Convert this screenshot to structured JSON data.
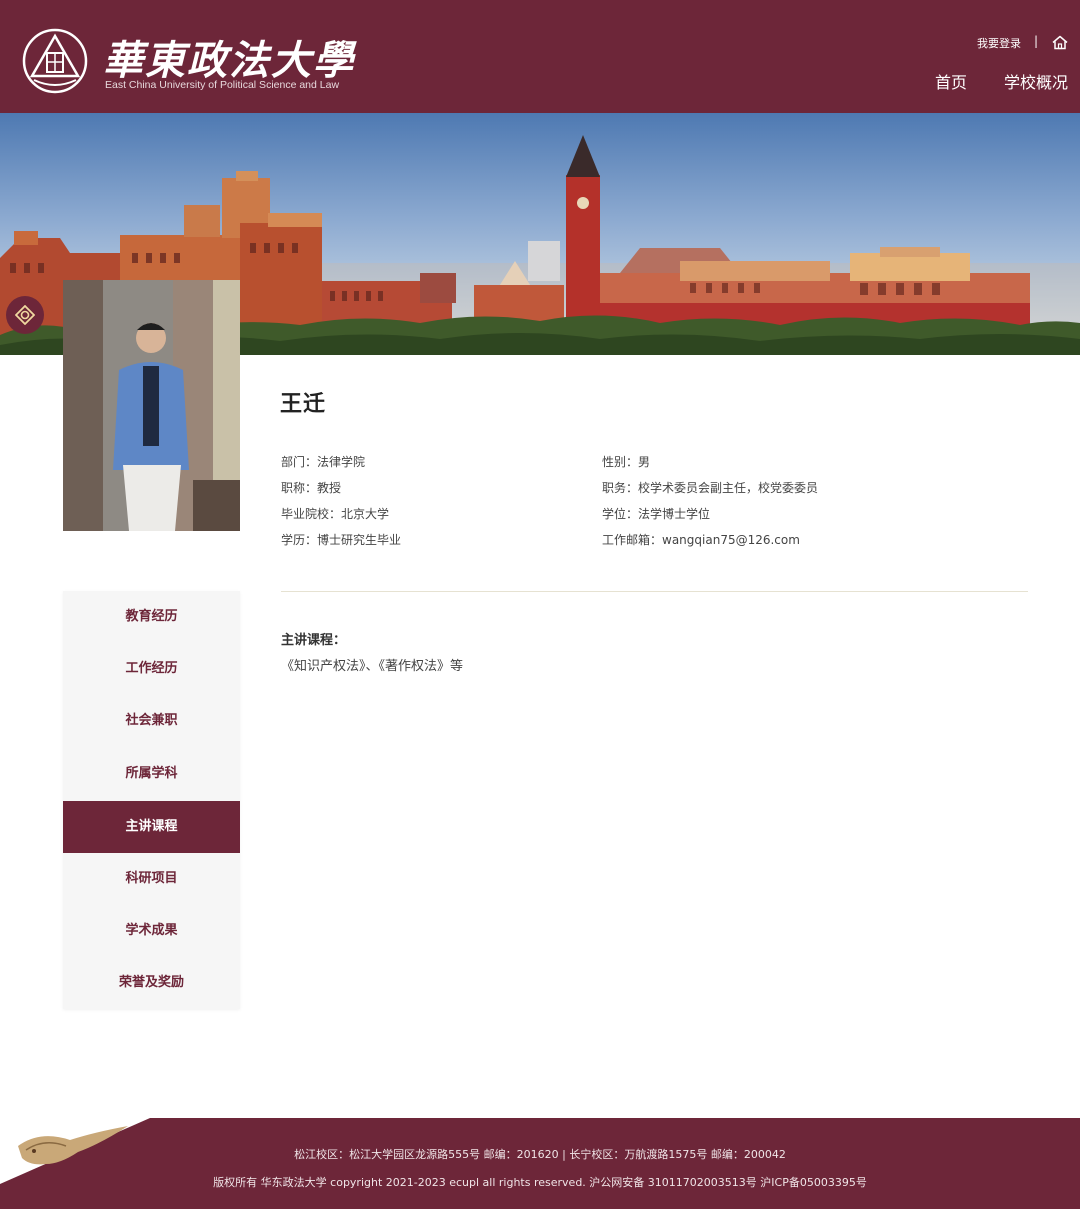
{
  "header": {
    "logo_cn": "華東政法大學",
    "logo_en": "East China University of Political Science and Law",
    "login_label": "我要登录",
    "separator": "|",
    "nav": [
      {
        "label": "首页"
      },
      {
        "label": "学校概况"
      }
    ]
  },
  "profile": {
    "name": "王迁",
    "info": [
      {
        "label": "部门：",
        "value": "法律学院"
      },
      {
        "label": "性别：",
        "value": "男"
      },
      {
        "label": "职称：",
        "value": "教授"
      },
      {
        "label": "职务：",
        "value": "校学术委员会副主任，校党委委员"
      },
      {
        "label": "毕业院校：",
        "value": "北京大学"
      },
      {
        "label": "学位：",
        "value": "法学博士学位"
      },
      {
        "label": "学历：",
        "value": "博士研究生毕业"
      },
      {
        "label": "工作邮箱：",
        "value": "wangqian75@126.com"
      }
    ]
  },
  "sidebar": {
    "items": [
      {
        "label": "教育经历"
      },
      {
        "label": "工作经历"
      },
      {
        "label": "社会兼职"
      },
      {
        "label": "所属学科"
      },
      {
        "label": "主讲课程"
      },
      {
        "label": "科研项目"
      },
      {
        "label": "学术成果"
      },
      {
        "label": "荣誉及奖励"
      }
    ],
    "active_index": 4
  },
  "content": {
    "section_title": "主讲课程：",
    "section_body": "《知识产权法》、《著作权法》等"
  },
  "footer": {
    "line1": "松江校区：松江大学园区龙源路555号 邮编：201620 | 长宁校区：万航渡路1575号 邮编：200042",
    "line2": "版权所有 华东政法大学 copyright 2021-2023 ecupl all rights reserved. 沪公网安备 31011702003513号 沪ICP备05003395号"
  },
  "colors": {
    "brand": "#6d2639",
    "sidebar_bg": "#f6f6f6",
    "divider": "#e6e2d2"
  },
  "icons": [
    "university-emblem-icon",
    "home-icon",
    "banner-badge-icon",
    "footer-dragon-icon"
  ]
}
